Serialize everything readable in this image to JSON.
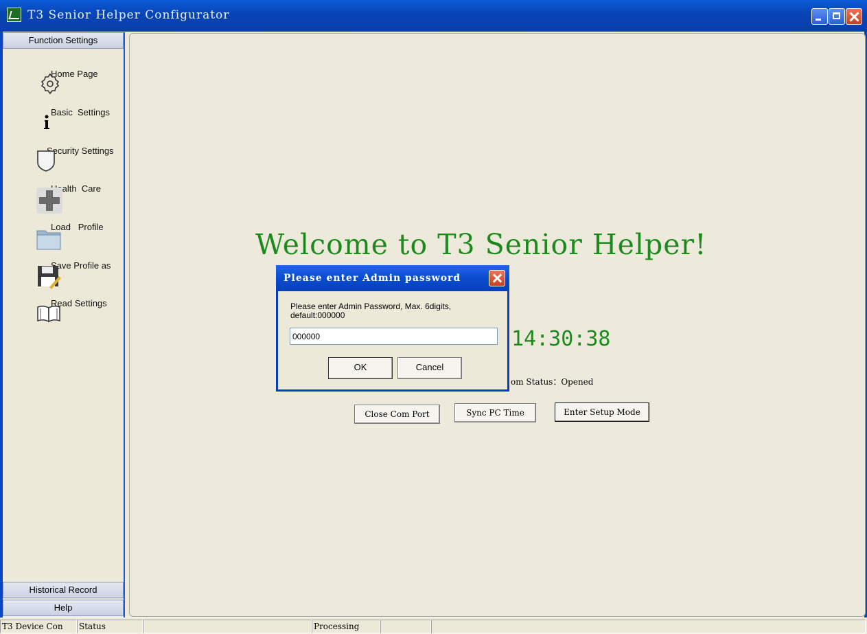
{
  "window": {
    "title": "T3 Senior Helper Configurator",
    "icon": "app-chart-icon",
    "accent": "#0A46C4"
  },
  "sidebar": {
    "header": "Function Settings",
    "items": [
      {
        "label": "Home Page",
        "icon": "gear-icon"
      },
      {
        "label": "Basic  Settings",
        "icon": "info-icon"
      },
      {
        "label": "Security Settings",
        "icon": "shield-icon"
      },
      {
        "label": "Health  Care",
        "icon": "medical-cross-icon"
      },
      {
        "label": "Load   Profile",
        "icon": "folder-icon"
      },
      {
        "label": "Save Profile as",
        "icon": "floppy-disk-icon"
      },
      {
        "label": "Read Settings",
        "icon": "book-icon"
      }
    ],
    "footer_sections": [
      "Historical Record",
      "Help"
    ]
  },
  "main": {
    "welcome": "Welcome to T3 Senior Helper!",
    "welcome_color": "#1E8A1E",
    "clock": "14:30:38",
    "com_status": "om Status：Opened",
    "buttons": {
      "close_com": "Close Com Port",
      "sync_time": "Sync PC Time",
      "setup_mode": "Enter Setup Mode"
    }
  },
  "dialog": {
    "title": "Please enter Admin password",
    "prompt": "Please enter Admin Password, Max. 6digits, default:000000",
    "value": "000000",
    "ok": "OK",
    "cancel": "Cancel"
  },
  "statusbar": {
    "panels": [
      "T3 Device Con",
      "Status",
      "",
      "Processing",
      "",
      ""
    ]
  }
}
